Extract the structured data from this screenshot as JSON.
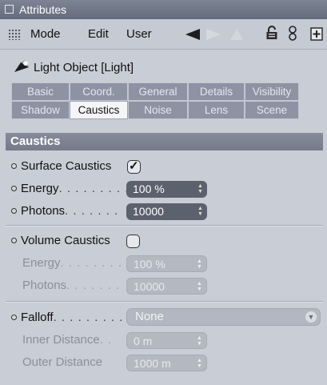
{
  "window": {
    "title": "Attributes"
  },
  "menubar": {
    "menus": [
      "Mode",
      "Edit",
      "User"
    ],
    "icons": [
      "grip-icon",
      "back-arrow-icon",
      "forward-arrow-icon",
      "up-arrow-icon",
      "lock-icon",
      "link-icon",
      "new-panel-icon"
    ]
  },
  "object": {
    "label": "Light Object [Light]",
    "icon": "spotlight-icon"
  },
  "tabs": {
    "row1": [
      "Basic",
      "Coord.",
      "General",
      "Details",
      "Visibility"
    ],
    "row2": [
      "Shadow",
      "Caustics",
      "Noise",
      "Lens",
      "Scene"
    ],
    "active": "Caustics"
  },
  "section": {
    "title": "Caustics"
  },
  "surface": {
    "label": "Surface Caustics",
    "checked": true,
    "energy": {
      "label": "Energy",
      "dots": ". . . . . . . . .",
      "value": "100 %"
    },
    "photons": {
      "label": "Photons",
      "dots": ". . . . . . .",
      "value": "10000"
    }
  },
  "volume": {
    "label": "Volume Caustics",
    "checked": false,
    "energy": {
      "label": "Energy",
      "dots": ". . . . . . . . .",
      "value": "100 %"
    },
    "photons": {
      "label": "Photons",
      "dots": ". . . . . . .",
      "value": "10000"
    }
  },
  "falloff": {
    "label": "Falloff",
    "dots": ". . . . . . . . . .",
    "value": "None",
    "inner": {
      "label": "Inner Distance",
      "dots": ". .",
      "value": "0 m"
    },
    "outer": {
      "label": "Outer Distance",
      "value": "1000 m"
    }
  },
  "colors": {
    "titlebar": "#6e7585",
    "panel": "#c9cdd5",
    "field_active": "#5c616e",
    "field_disabled": "#b4b8c1",
    "tab_inactive": "#8d93a3"
  }
}
